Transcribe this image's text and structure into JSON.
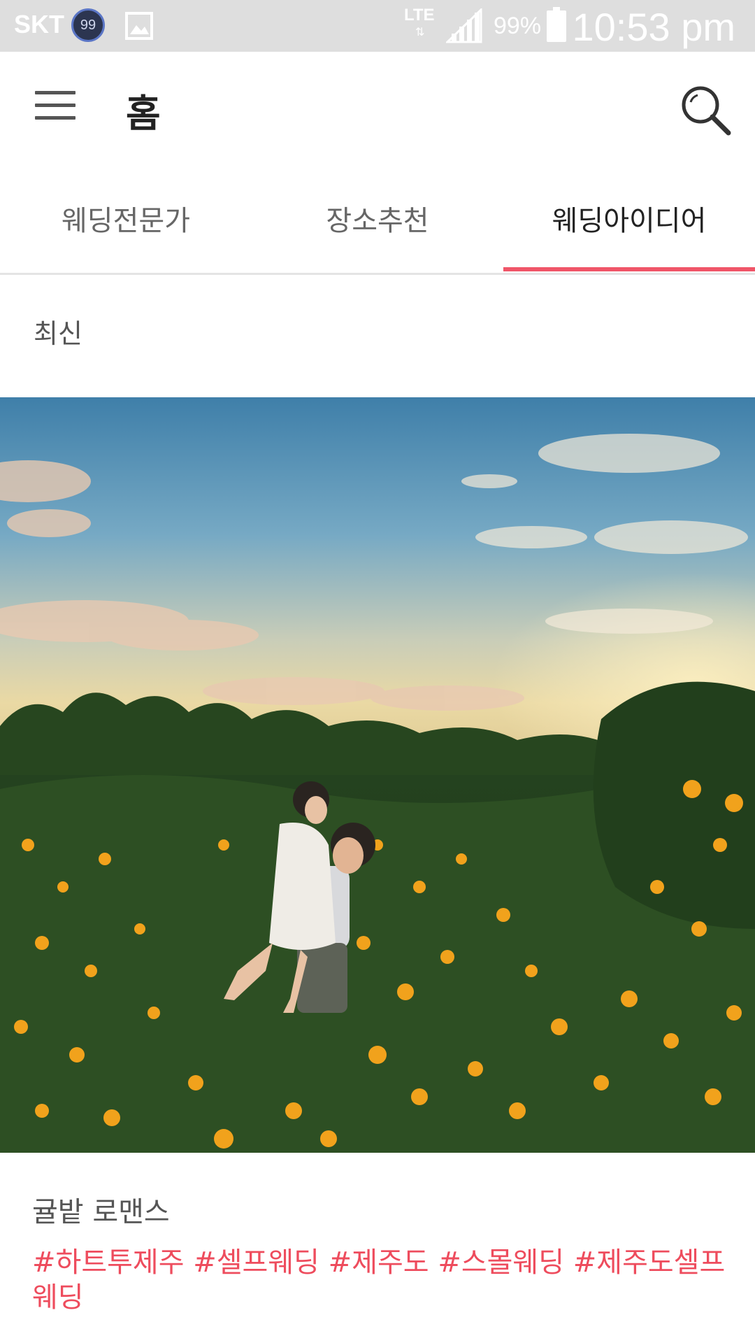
{
  "status_bar": {
    "carrier": "SKT",
    "notification_badge": "99",
    "network": "LTE",
    "battery_percent": "99%",
    "time": "10:53 pm"
  },
  "app_bar": {
    "title": "홈",
    "menu_icon": "hamburger-menu-icon",
    "search_icon": "search-icon"
  },
  "tabs": [
    {
      "label": "웨딩전문가",
      "active": false
    },
    {
      "label": "장소추천",
      "active": false
    },
    {
      "label": "웨딩아이디어",
      "active": true
    }
  ],
  "accent_color": "#f05568",
  "section": {
    "label": "최신"
  },
  "feed": {
    "post_title": "귤밭 로맨스",
    "hashtags": [
      "#하트투제주",
      "#셀프웨딩",
      "#제주도",
      "#스몰웨딩",
      "#제주도셀프웨딩"
    ]
  }
}
